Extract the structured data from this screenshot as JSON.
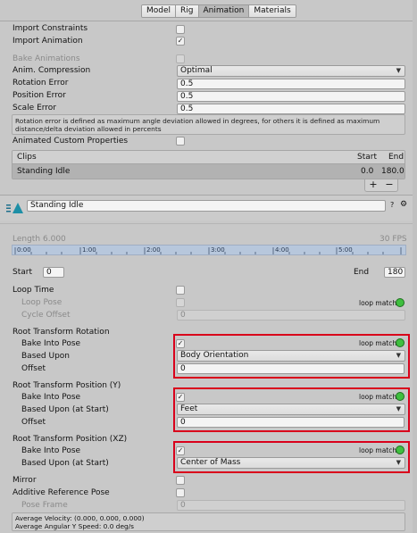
{
  "tabs": [
    {
      "label": "Model",
      "active": false
    },
    {
      "label": "Rig",
      "active": false
    },
    {
      "label": "Animation",
      "active": true
    },
    {
      "label": "Materials",
      "active": false
    }
  ],
  "import": {
    "constraints_label": "Import Constraints",
    "constraints_checked": false,
    "animation_label": "Import Animation",
    "animation_checked": true,
    "bake_label": "Bake Animations",
    "compression_label": "Anim. Compression",
    "compression_value": "Optimal",
    "rotation_error_label": "Rotation Error",
    "rotation_error_value": "0.5",
    "position_error_label": "Position Error",
    "position_error_value": "0.5",
    "scale_error_label": "Scale Error",
    "scale_error_value": "0.5",
    "hint_text": "Rotation error is defined as maximum angle deviation allowed in degrees, for others it is defined as maximum distance/delta deviation allowed in percents",
    "custom_props_label": "Animated Custom Properties"
  },
  "clips": {
    "header": "Clips",
    "col_start": "Start",
    "col_end": "End",
    "rows": [
      {
        "name": "Standing Idle",
        "start": "0.0",
        "end": "180.0"
      }
    ],
    "plus": "+",
    "minus": "−"
  },
  "clip_editor": {
    "name": "Standing Idle",
    "help_icon": "?",
    "gear_icon": "⚙",
    "length_label": "Length",
    "length_value": "6.000",
    "fps": "30 FPS",
    "timeline_ticks": [
      "0:00",
      "1:00",
      "2:00",
      "3:00",
      "4:00",
      "5:00"
    ],
    "start_label": "Start",
    "start_value": "0",
    "end_label": "End",
    "end_value": "180",
    "loop_time_label": "Loop Time",
    "loop_pose_label": "Loop Pose",
    "cycle_offset_label": "Cycle Offset",
    "cycle_offset_value": "0",
    "loop_match": "loop match"
  },
  "root_rotation": {
    "title": "Root Transform Rotation",
    "bake_label": "Bake Into Pose",
    "based_label": "Based Upon",
    "based_value": "Body Orientation",
    "offset_label": "Offset",
    "offset_value": "0"
  },
  "root_position_y": {
    "title": "Root Transform Position (Y)",
    "bake_label": "Bake Into Pose",
    "based_label": "Based Upon (at Start)",
    "based_value": "Feet",
    "offset_label": "Offset",
    "offset_value": "0"
  },
  "root_position_xz": {
    "title": "Root Transform Position (XZ)",
    "bake_label": "Bake Into Pose",
    "based_label": "Based Upon (at Start)",
    "based_value": "Center of Mass"
  },
  "misc": {
    "mirror_label": "Mirror",
    "additive_label": "Additive Reference Pose",
    "pose_frame_label": "Pose Frame",
    "pose_frame_value": "0",
    "avg_velocity": "Average Velocity: (0.000, 0.000, 0.000)",
    "avg_angular": "Average Angular Y Speed: 0.0 deg/s"
  },
  "colors": {
    "loop_match_green": "#3fbf3f",
    "highlight_red": "#d9001b",
    "timeline_blue": "#b7c7dc"
  }
}
